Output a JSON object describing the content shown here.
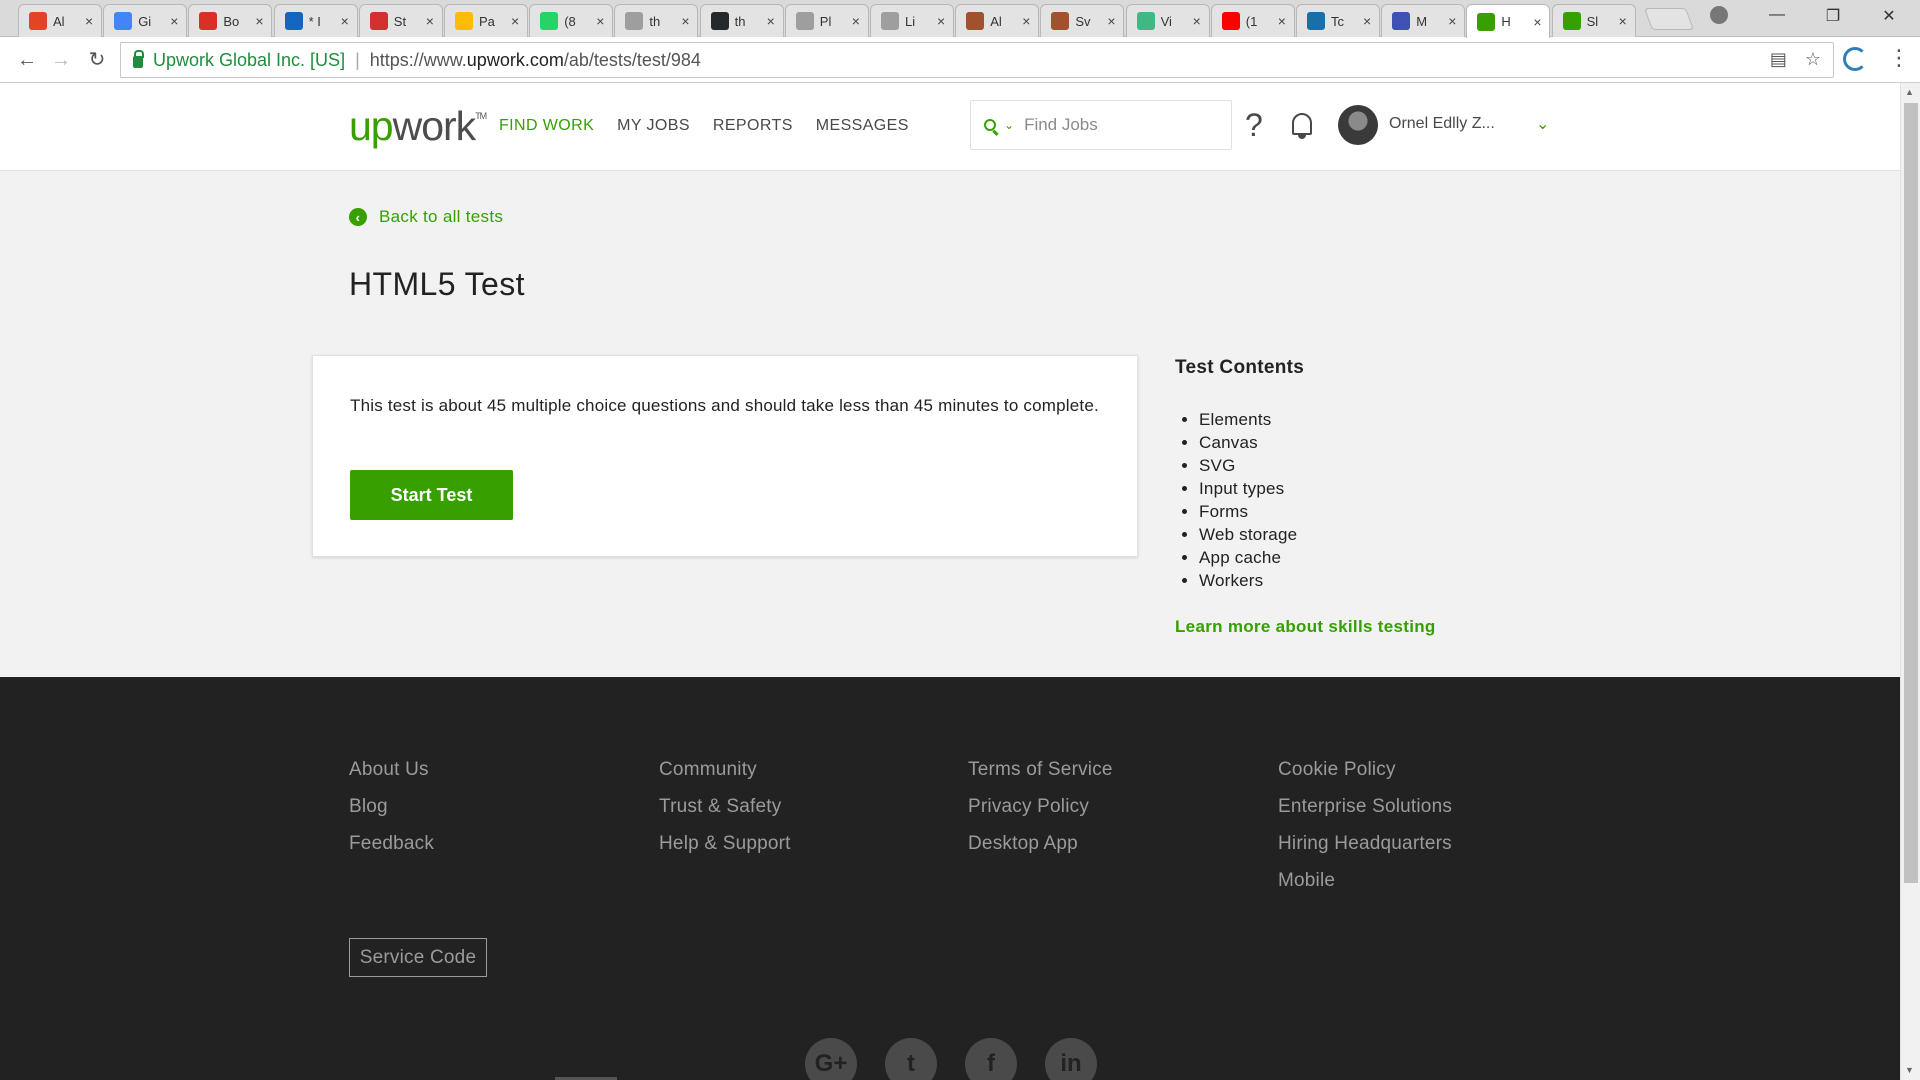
{
  "browser": {
    "tabs": [
      {
        "icon": "gitlab-icon",
        "title": "Al",
        "color": "#e24329"
      },
      {
        "icon": "google-translate-icon",
        "title": "Gi",
        "color": "#4285f4"
      },
      {
        "icon": "gmail-icon",
        "title": "Bo",
        "color": "#d93025"
      },
      {
        "icon": "generic-app-icon",
        "title": "* I",
        "color": "#1565c0"
      },
      {
        "icon": "pdf-icon",
        "title": "St",
        "color": "#d32f2f"
      },
      {
        "icon": "google-drive-icon",
        "title": "Pa",
        "color": "#fbbc04"
      },
      {
        "icon": "whatsapp-icon",
        "title": "(8",
        "color": "#25d366"
      },
      {
        "icon": "document-icon",
        "title": "th",
        "color": "#9e9e9e"
      },
      {
        "icon": "github-icon",
        "title": "th",
        "color": "#24292e"
      },
      {
        "icon": "document-icon",
        "title": "Pl",
        "color": "#9e9e9e"
      },
      {
        "icon": "document-icon",
        "title": "Li",
        "color": "#9e9e9e"
      },
      {
        "icon": "person-icon",
        "title": "Al",
        "color": "#a0522d"
      },
      {
        "icon": "person-icon",
        "title": "Sv",
        "color": "#a0522d"
      },
      {
        "icon": "vue-icon",
        "title": "Vi",
        "color": "#41b883"
      },
      {
        "icon": "youtube-icon",
        "title": "(1",
        "color": "#ff0000"
      },
      {
        "icon": "t9-icon",
        "title": "Tc",
        "color": "#1a6fa8"
      },
      {
        "icon": "app-icon",
        "title": "M",
        "color": "#3f51b5"
      },
      {
        "icon": "upwork-icon",
        "title": "H",
        "color": "#37a000",
        "active": true
      },
      {
        "icon": "upwork-icon",
        "title": "Sl",
        "color": "#37a000"
      }
    ],
    "address": {
      "org": "Upwork Global Inc. [US]",
      "url_prefix": "https://www.",
      "url_domain": "upwork.com",
      "url_path": "/ab/tests/test/984"
    }
  },
  "header": {
    "logo_up": "up",
    "logo_work": "work",
    "nav": {
      "find_work": "FIND WORK",
      "my_jobs": "MY JOBS",
      "reports": "REPORTS",
      "messages": "MESSAGES"
    },
    "search": {
      "placeholder": "Find Jobs"
    },
    "help_glyph": "?",
    "user_name": "Ornel Edlly Z..."
  },
  "main": {
    "back_link": "Back to all tests",
    "title": "HTML5 Test",
    "description": "This test is about 45 multiple choice questions and should take less than 45 minutes to complete.",
    "start_button": "Start Test",
    "contents_title": "Test Contents",
    "contents": [
      "Elements",
      "Canvas",
      "SVG",
      "Input types",
      "Forms",
      "Web storage",
      "App cache",
      "Workers"
    ],
    "learn_more": "Learn more about skills testing"
  },
  "footer": {
    "col1": [
      "About Us",
      "Blog",
      "Feedback"
    ],
    "col2": [
      "Community",
      "Trust & Safety",
      "Help & Support"
    ],
    "col3": [
      "Terms of Service",
      "Privacy Policy",
      "Desktop App"
    ],
    "col4": [
      "Cookie Policy",
      "Enterprise Solutions",
      "Hiring Headquarters",
      "Mobile"
    ],
    "service_code": "Service Code",
    "social": [
      {
        "name": "google-plus-icon",
        "glyph": "G+"
      },
      {
        "name": "twitter-icon",
        "glyph": "t"
      },
      {
        "name": "facebook-icon",
        "glyph": "f"
      },
      {
        "name": "linkedin-icon",
        "glyph": "in"
      }
    ]
  },
  "colors": {
    "brand_green": "#37a000",
    "footer_bg": "#222222",
    "page_bg": "#f2f2f2"
  }
}
